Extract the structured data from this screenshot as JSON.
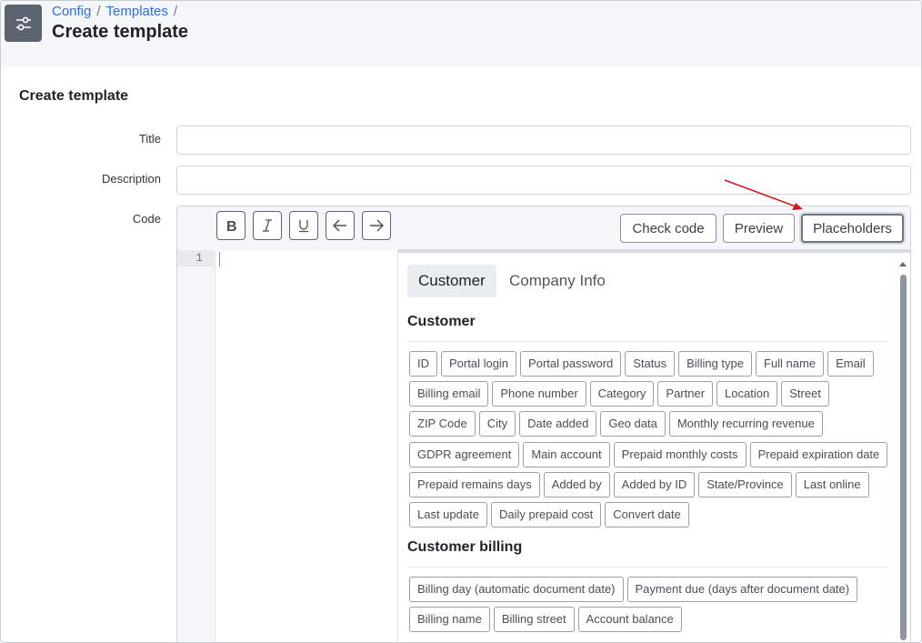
{
  "header": {
    "breadcrumb": [
      "Config",
      "Templates"
    ],
    "title": "Create template"
  },
  "form": {
    "section_title": "Create template",
    "title_label": "Title",
    "title_value": "",
    "description_label": "Description",
    "description_value": "",
    "code_label": "Code"
  },
  "editor": {
    "toolbar": {
      "icons": [
        "bold-icon",
        "italic-icon",
        "underline-icon",
        "undo-icon",
        "redo-icon"
      ],
      "check_code": "Check code",
      "preview": "Preview",
      "placeholders": "Placeholders"
    },
    "line_number": "1"
  },
  "placeholders": {
    "tabs": [
      "Customer",
      "Company Info"
    ],
    "active_tab": "Customer",
    "groups": [
      {
        "title": "Customer",
        "rows": [
          [
            "ID",
            "Portal login",
            "Portal password",
            "Status",
            "Billing type",
            "Full name",
            "Email"
          ],
          [
            "Billing email",
            "Phone number",
            "Category",
            "Partner",
            "Location",
            "Street"
          ],
          [
            "ZIP Code",
            "City",
            "Date added",
            "Geo data",
            "Monthly recurring revenue"
          ],
          [
            "GDPR agreement",
            "Main account",
            "Prepaid monthly costs",
            "Prepaid expiration date"
          ],
          [
            "Prepaid remains days",
            "Added by",
            "Added by ID",
            "State/Province",
            "Last online"
          ],
          [
            "Last update",
            "Daily prepaid cost",
            "Convert date"
          ]
        ]
      },
      {
        "title": "Customer billing",
        "rows": [
          [
            "Billing day (automatic document date)",
            "Payment due (days after document date)"
          ],
          [
            "Billing name",
            "Billing street",
            "Account balance"
          ]
        ]
      }
    ]
  },
  "colors": {
    "link": "#2a6fdb",
    "annotation_arrow": "#d0191e",
    "header_bg": "#f5f6f9"
  }
}
